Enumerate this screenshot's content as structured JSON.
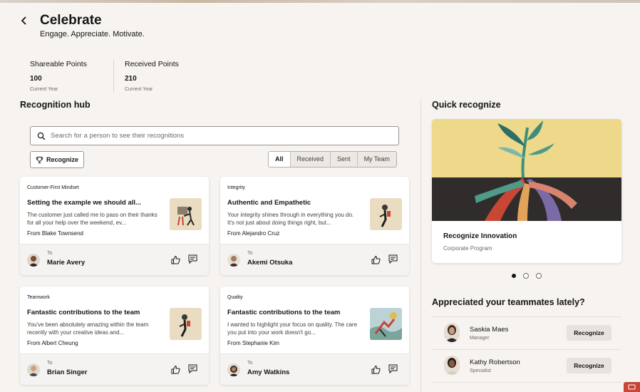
{
  "header": {
    "back_icon": "chevron-left-icon",
    "title": "Celebrate",
    "subtitle": "Engage. Appreciate. Motivate."
  },
  "points": [
    {
      "label": "Shareable Points",
      "value": "100",
      "period": "Current Year"
    },
    {
      "label": "Received Points",
      "value": "210",
      "period": "Current Year"
    }
  ],
  "hub": {
    "title": "Recognition hub",
    "search_placeholder": "Search for a person to see their recognitions",
    "recognize_label": "Recognize",
    "filters": [
      "All",
      "Received",
      "Sent",
      "My Team"
    ],
    "active_filter": "All",
    "to_label": "To",
    "cards": [
      {
        "category": "Customer-First Mindset",
        "title": "Setting the example we should all...",
        "body": "The customer just called me to pass on their thanks for all your help over the weekend, ev...",
        "from": "From Blake Townsend",
        "to": "Marie Avery"
      },
      {
        "category": "Integrity",
        "title": "Authentic and Empathetic",
        "body": "Your integrity shines through in everything you do. It's not just about doing things right, but...",
        "from": "From Alejandro Cruz",
        "to": "Akemi Otsuka"
      },
      {
        "category": "Teamwork",
        "title": "Fantastic contributions to the team",
        "body": "You've been absolutely amazing within the team recently with your creative ideas and...",
        "from": "From Albert Cheung",
        "to": "Brian Singer"
      },
      {
        "category": "Quality",
        "title": "Fantastic contributions to the team",
        "body": "I wanted to highlight your focus on quality. The care you put into your work doesn't go...",
        "from": "From Stephanie Kim",
        "to": "Amy Watkins"
      }
    ]
  },
  "quick": {
    "title": "Quick recognize",
    "carousel": {
      "title": "Recognize Innovation",
      "subtitle": "Corporate Program",
      "pages": 3,
      "active_page": 1
    }
  },
  "teammates": {
    "title": "Appreciated your teammates lately?",
    "button_label": "Recognize",
    "items": [
      {
        "name": "Saskia Maes",
        "role": "Manager"
      },
      {
        "name": "Kathy Robertson",
        "role": "Specialist"
      }
    ]
  },
  "colors": {
    "accent": "#c74634",
    "background": "#f6f3f0",
    "card": "#ffffff"
  }
}
